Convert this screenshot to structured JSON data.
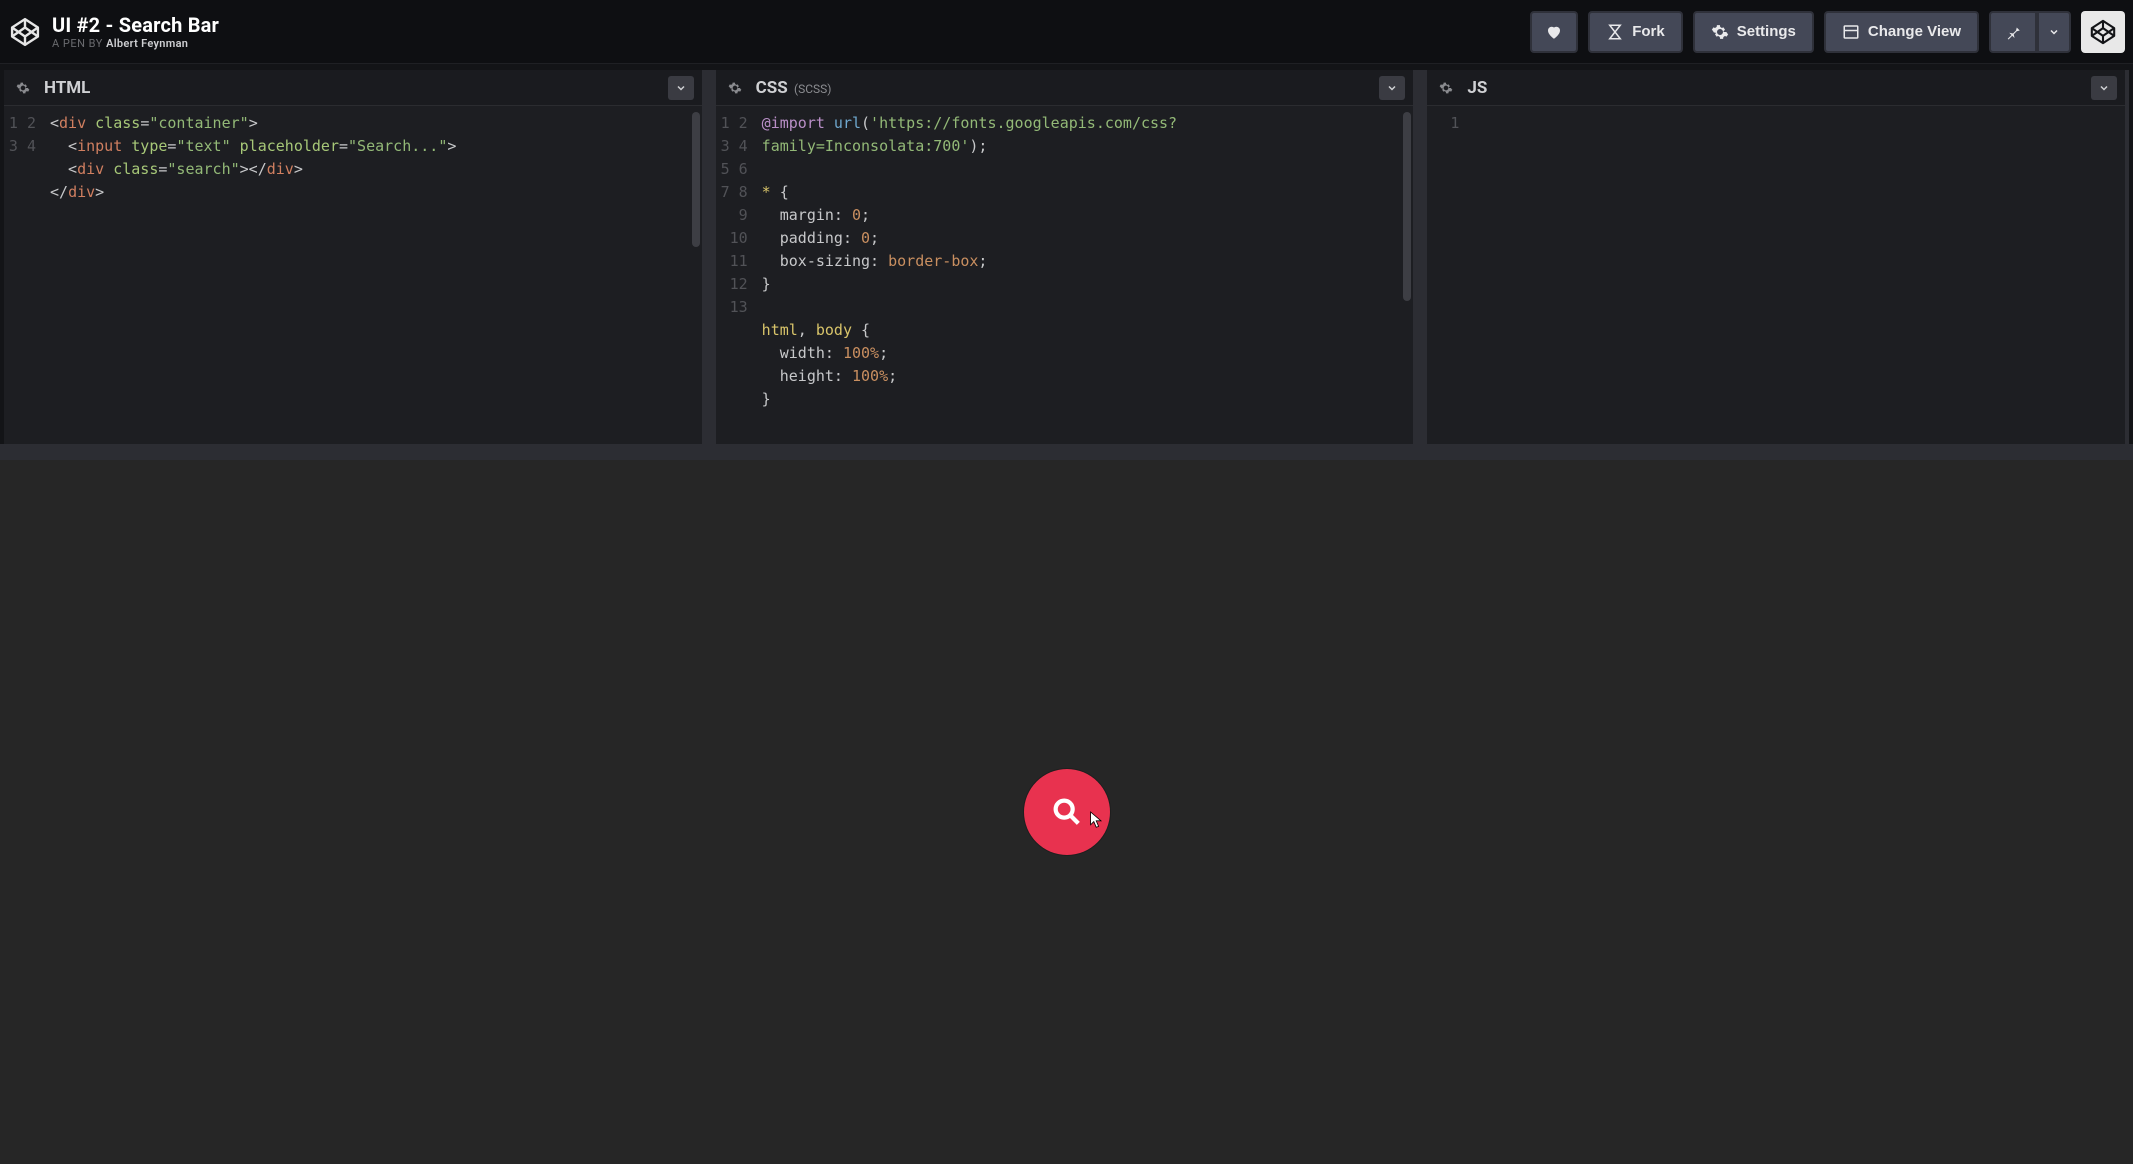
{
  "header": {
    "title": "UI #2 - Search Bar",
    "byline_prefix": "A PEN BY ",
    "author": "Albert Feynman",
    "buttons": {
      "fork": "Fork",
      "settings": "Settings",
      "change_view": "Change View"
    }
  },
  "panes": {
    "html": {
      "title": "HTML",
      "subtitle": "",
      "line_count": 4,
      "lines": [
        [
          {
            "c": "p",
            "t": "<"
          },
          {
            "c": "t",
            "t": "div"
          },
          {
            "c": "p",
            "t": " "
          },
          {
            "c": "a",
            "t": "class"
          },
          {
            "c": "p",
            "t": "="
          },
          {
            "c": "s",
            "t": "\"container\""
          },
          {
            "c": "p",
            "t": ">"
          }
        ],
        [
          {
            "c": "p",
            "t": "  <"
          },
          {
            "c": "t",
            "t": "input"
          },
          {
            "c": "p",
            "t": " "
          },
          {
            "c": "a",
            "t": "type"
          },
          {
            "c": "p",
            "t": "="
          },
          {
            "c": "s",
            "t": "\"text\""
          },
          {
            "c": "p",
            "t": " "
          },
          {
            "c": "a",
            "t": "placeholder"
          },
          {
            "c": "p",
            "t": "="
          },
          {
            "c": "s",
            "t": "\"Search...\""
          },
          {
            "c": "p",
            "t": ">"
          }
        ],
        [
          {
            "c": "p",
            "t": "  <"
          },
          {
            "c": "t",
            "t": "div"
          },
          {
            "c": "p",
            "t": " "
          },
          {
            "c": "a",
            "t": "class"
          },
          {
            "c": "p",
            "t": "="
          },
          {
            "c": "s",
            "t": "\"search\""
          },
          {
            "c": "p",
            "t": "></"
          },
          {
            "c": "t",
            "t": "div"
          },
          {
            "c": "p",
            "t": ">"
          }
        ],
        [
          {
            "c": "p",
            "t": "</"
          },
          {
            "c": "t",
            "t": "div"
          },
          {
            "c": "p",
            "t": ">"
          }
        ]
      ]
    },
    "css": {
      "title": "CSS",
      "subtitle": "(SCSS)",
      "line_count": 13,
      "lines": [
        [
          {
            "c": "kw",
            "t": "@import"
          },
          {
            "c": "p",
            "t": " "
          },
          {
            "c": "fn",
            "t": "url"
          },
          {
            "c": "p",
            "t": "("
          },
          {
            "c": "s",
            "t": "'https://fonts.googleapis.com/css?"
          }
        ],
        [
          {
            "c": "s",
            "t": "family=Inconsolata:700'"
          },
          {
            "c": "p",
            "t": ");"
          }
        ],
        [],
        [
          {
            "c": "se",
            "t": "*"
          },
          {
            "c": "p",
            "t": " {"
          }
        ],
        [
          {
            "c": "p",
            "t": "  "
          },
          {
            "c": "pr",
            "t": "margin"
          },
          {
            "c": "p",
            "t": ": "
          },
          {
            "c": "n",
            "t": "0"
          },
          {
            "c": "p",
            "t": ";"
          }
        ],
        [
          {
            "c": "p",
            "t": "  "
          },
          {
            "c": "pr",
            "t": "padding"
          },
          {
            "c": "p",
            "t": ": "
          },
          {
            "c": "n",
            "t": "0"
          },
          {
            "c": "p",
            "t": ";"
          }
        ],
        [
          {
            "c": "p",
            "t": "  "
          },
          {
            "c": "pr",
            "t": "box-sizing"
          },
          {
            "c": "p",
            "t": ": "
          },
          {
            "c": "v",
            "t": "border-box"
          },
          {
            "c": "p",
            "t": ";"
          }
        ],
        [
          {
            "c": "p",
            "t": "}"
          }
        ],
        [],
        [
          {
            "c": "se",
            "t": "html"
          },
          {
            "c": "p",
            "t": ", "
          },
          {
            "c": "se",
            "t": "body"
          },
          {
            "c": "p",
            "t": " {"
          }
        ],
        [
          {
            "c": "p",
            "t": "  "
          },
          {
            "c": "pr",
            "t": "width"
          },
          {
            "c": "p",
            "t": ": "
          },
          {
            "c": "n",
            "t": "100%"
          },
          {
            "c": "p",
            "t": ";"
          }
        ],
        [
          {
            "c": "p",
            "t": "  "
          },
          {
            "c": "pr",
            "t": "height"
          },
          {
            "c": "p",
            "t": ": "
          },
          {
            "c": "n",
            "t": "100%"
          },
          {
            "c": "p",
            "t": ";"
          }
        ],
        [
          {
            "c": "p",
            "t": "}"
          }
        ]
      ]
    },
    "js": {
      "title": "JS",
      "subtitle": "",
      "line_count": 1,
      "lines": [
        []
      ]
    }
  },
  "output": {
    "search_button_color": "#e8324f"
  }
}
